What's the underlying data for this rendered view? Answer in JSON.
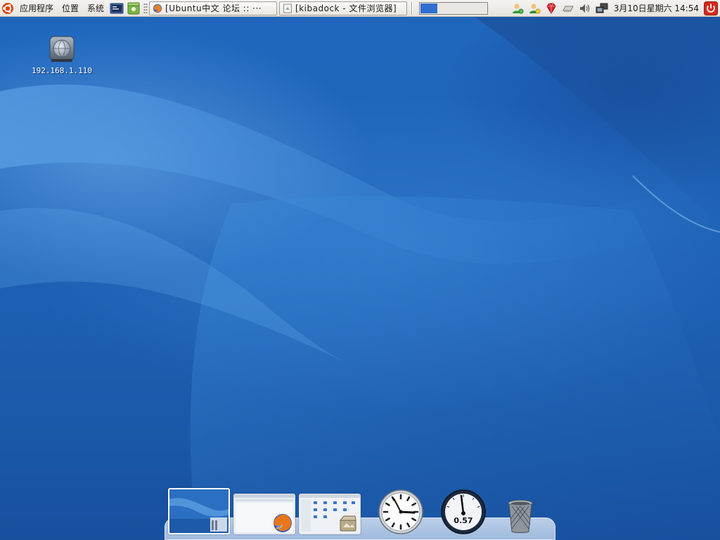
{
  "top_panel": {
    "menus": {
      "applications": "应用程序",
      "places": "位置",
      "system": "系统"
    },
    "tasks": [
      {
        "label": "[Ubuntu中文 论坛 :: ···",
        "icon": "firefox-icon"
      },
      {
        "label": "[kibadock - 文件浏览器]",
        "icon": "file-browser-icon"
      }
    ],
    "network_monitor_level_percent": 25,
    "clock": "3月10日星期六  14:54",
    "colors": {
      "panel_bg": "#e9e7e2",
      "accent_blue": "#2f6fd0",
      "power_red": "#d8281e"
    }
  },
  "desktop": {
    "icons": [
      {
        "label": "192.168.1.110",
        "icon": "network-share-icon"
      }
    ]
  },
  "dock": {
    "items": [
      {
        "name": "desktop-thumbnail",
        "icon": "desktop-preview-icon"
      },
      {
        "name": "firefox-window",
        "icon": "firefox-icon"
      },
      {
        "name": "file-browser-window",
        "icon": "file-manager-icon"
      },
      {
        "name": "clock-widget",
        "icon": "analog-clock-icon"
      },
      {
        "name": "cpu-gauge",
        "icon": "gauge-icon",
        "value": "0.57"
      },
      {
        "name": "trash",
        "icon": "trash-icon"
      }
    ]
  }
}
